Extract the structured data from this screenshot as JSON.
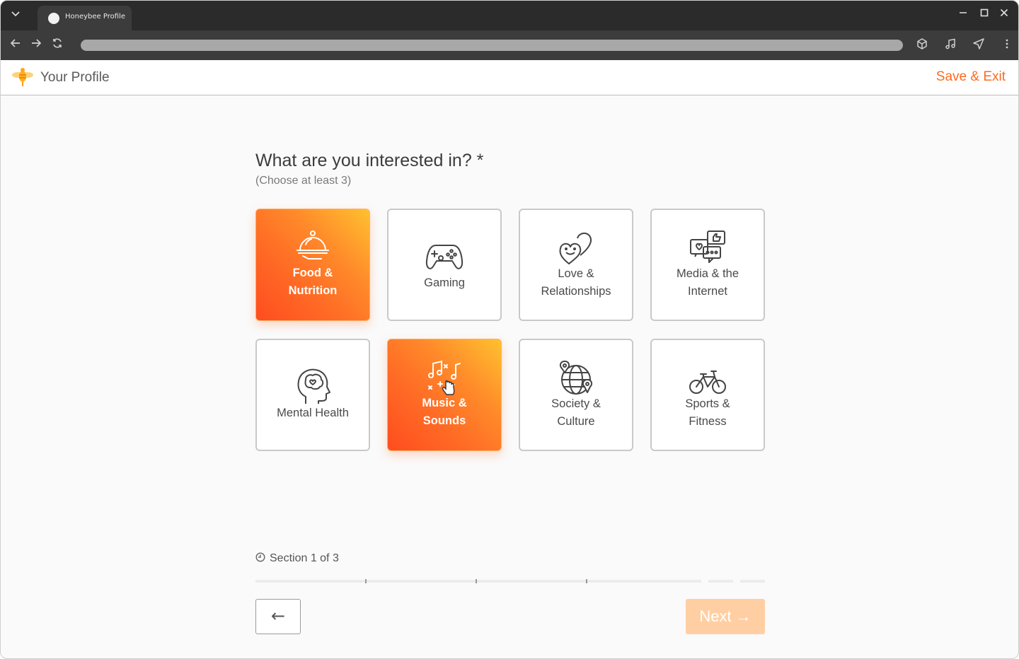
{
  "browser": {
    "tab_title": "Honeybee Profile",
    "icons": [
      "chevron-down-icon",
      "back-arrow-icon",
      "forward-arrow-icon",
      "reload-icon",
      "cube-icon",
      "music-note-icon",
      "send-icon",
      "kebab-menu-icon",
      "minimize-icon",
      "maximize-icon",
      "close-icon"
    ]
  },
  "header": {
    "title": "Your Profile",
    "save_exit": "Save & Exit",
    "accent_color": "#ff6a1f"
  },
  "main": {
    "question": "What are you interested in? *",
    "subtitle": "(Choose at least 3)",
    "interests": [
      {
        "label_line1": "Food &",
        "label_line2": "Nutrition",
        "icon": "food-cloche-icon",
        "selected": true
      },
      {
        "label_line1": "Gaming",
        "label_line2": "",
        "icon": "gamepad-icon",
        "selected": false
      },
      {
        "label_line1": "Love &",
        "label_line2": "Relationships",
        "icon": "hearts-icon",
        "selected": false
      },
      {
        "label_line1": "Media & the",
        "label_line2": "Internet",
        "icon": "chat-bubbles-icon",
        "selected": false
      },
      {
        "label_line1": "Mental Health",
        "label_line2": "",
        "icon": "brain-head-icon",
        "selected": false
      },
      {
        "label_line1": "Music &",
        "label_line2": "Sounds",
        "icon": "music-notes-icon",
        "selected": true
      },
      {
        "label_line1": "Society &",
        "label_line2": "Culture",
        "icon": "globe-pins-icon",
        "selected": false
      },
      {
        "label_line1": "Sports &",
        "label_line2": "Fitness",
        "icon": "bicycle-icon",
        "selected": false
      }
    ]
  },
  "footer": {
    "section_text": "Section 1 of 3",
    "back_label": "←",
    "next_label": "Next",
    "next_arrow": "→"
  }
}
